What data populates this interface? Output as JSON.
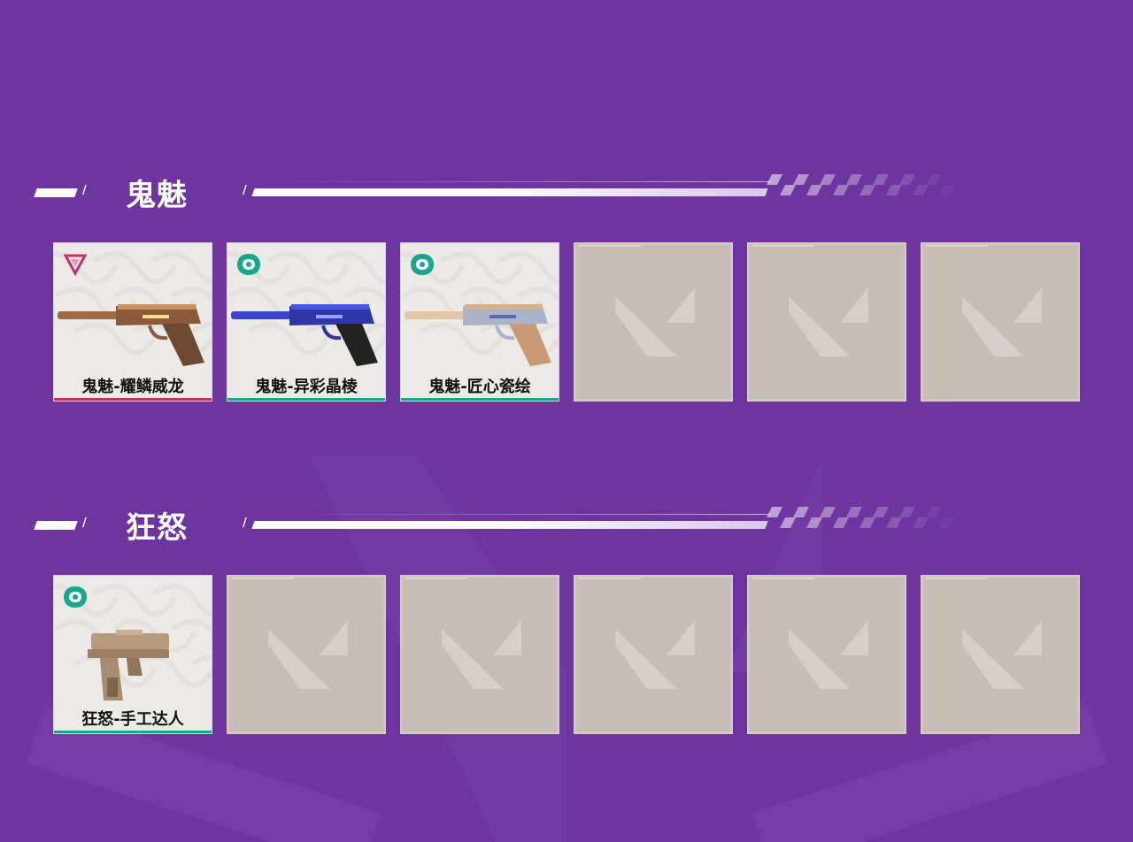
{
  "colors": {
    "background": "#6e34a0",
    "card_bg": "#eceae6",
    "empty_card_bg": "#c6bdb4",
    "exclusive_accent": "#c0306f",
    "deluxe_accent": "#1aa58f"
  },
  "sections": [
    {
      "title": "鬼魅",
      "cards": [
        {
          "state": "owned",
          "name": "鬼魅-耀鳞威龙",
          "tier_icon": "exclusive-tier-icon",
          "accent": "#c0306f",
          "gun_style": "gold"
        },
        {
          "state": "owned",
          "name": "鬼魅-异彩晶棱",
          "tier_icon": "deluxe-tier-icon",
          "accent": "#1aa58f",
          "gun_style": "blue"
        },
        {
          "state": "owned",
          "name": "鬼魅-匠心瓷绘",
          "tier_icon": "deluxe-tier-icon",
          "accent": "#1aa58f",
          "gun_style": "porcelain"
        },
        {
          "state": "empty"
        },
        {
          "state": "empty"
        },
        {
          "state": "empty"
        }
      ]
    },
    {
      "title": "狂怒",
      "cards": [
        {
          "state": "owned",
          "name": "狂怒-手工达人",
          "tier_icon": "deluxe-tier-icon",
          "accent": "#1aa58f",
          "gun_style": "frenzy"
        },
        {
          "state": "empty"
        },
        {
          "state": "empty"
        },
        {
          "state": "empty"
        },
        {
          "state": "empty"
        },
        {
          "state": "empty"
        }
      ]
    }
  ]
}
